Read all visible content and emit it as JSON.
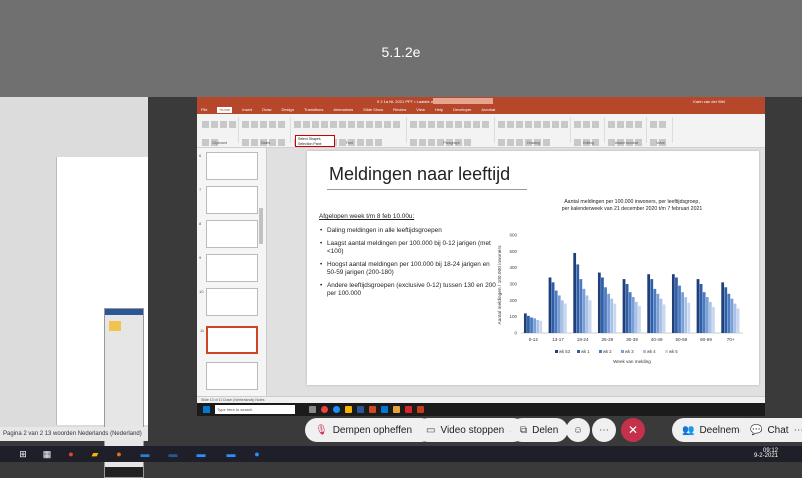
{
  "meeting": {
    "title": "5.1.2e"
  },
  "document": {
    "status_text": "Pagina 2 van 2   13 woorden   Nederlands (Nederland)"
  },
  "powerpoint": {
    "window_title": "9 2 1a NL 2021 PPT  •  Laatste wijziging",
    "user": "Karin van der Wel",
    "tabs": [
      "File",
      "Home",
      "Insert",
      "Draw",
      "Design",
      "Transitions",
      "Animations",
      "Slide Show",
      "Review",
      "View",
      "Help",
      "Developer",
      "Acrobat"
    ],
    "active_tab": "Home",
    "popup_lines": [
      "Select Shapes",
      "Selection Pane"
    ],
    "ribbon_groups": [
      "Clipboard",
      "Slides",
      "Font",
      "Paragraph",
      "Drawing",
      "Editing",
      "Adobe Acrobat",
      "Voice"
    ],
    "status_text": "Slide 10 of 11   Dutch (Netherlands)   Notes",
    "taskbar_search": "Type here to search",
    "thumb_numbers": [
      "6",
      "7",
      "8",
      "9",
      "10",
      "11"
    ]
  },
  "slide": {
    "title": "Meldingen naar leeftijd",
    "lead": "Afgelopen week t/m 8 feb 10.00u:",
    "bullets": [
      "Daling meldingen in alle leeftijdsgroepen",
      "Laagst aantal meldingen per 100.000 bij 0-12 jarigen (met <100)",
      "Hoogst aantal meldingen per 100.000 bij 18-24 jarigen en 50-59 jarigen (200-180)",
      "Andere leeftijdsgroepen (exclusive 0-12) tussen 130 en 200 per 100.000"
    ]
  },
  "chart_data": {
    "type": "bar",
    "title": "Aantal meldingen per 100.000 inwoners, per leeftijdsgroep, per kalenderweek van 21 december 2020 t/m 7 februari 2021",
    "xlabel": "Week van melding",
    "ylabel": "Aantal meldingen / 100.000 inwoners",
    "ylim": [
      0,
      600
    ],
    "yticks": [
      0,
      100,
      200,
      300,
      400,
      500,
      600
    ],
    "categories": [
      "0-12",
      "13-17",
      "18-24",
      "25-29",
      "30-39",
      "40-49",
      "50-59",
      "60-69",
      "70+"
    ],
    "series": [
      {
        "name": "wk 53",
        "values": [
          120,
          340,
          490,
          370,
          330,
          360,
          360,
          330,
          310
        ]
      },
      {
        "name": "wk 1",
        "values": [
          105,
          310,
          420,
          340,
          300,
          330,
          340,
          300,
          280
        ]
      },
      {
        "name": "wk 2",
        "values": [
          95,
          260,
          330,
          280,
          250,
          270,
          290,
          250,
          240
        ]
      },
      {
        "name": "wk 3",
        "values": [
          90,
          230,
          270,
          240,
          220,
          240,
          250,
          220,
          210
        ]
      },
      {
        "name": "wk 4",
        "values": [
          80,
          200,
          230,
          210,
          190,
          210,
          220,
          190,
          180
        ]
      },
      {
        "name": "wk 5",
        "values": [
          75,
          180,
          200,
          180,
          165,
          175,
          185,
          160,
          150
        ]
      }
    ],
    "colors": [
      "#1f3f7a",
      "#2e5ea8",
      "#4a7ac0",
      "#7b9fd4",
      "#a9c1e6",
      "#c9d8f0"
    ],
    "legend_position": "bottom"
  },
  "controls": {
    "unmute": "Dempen opheffen",
    "video": "Video stoppen",
    "share": "Delen",
    "participants": "Deelnemers",
    "chat": "Chat"
  },
  "taskbar": {
    "time": "09:12",
    "date": "9-2-2021"
  }
}
